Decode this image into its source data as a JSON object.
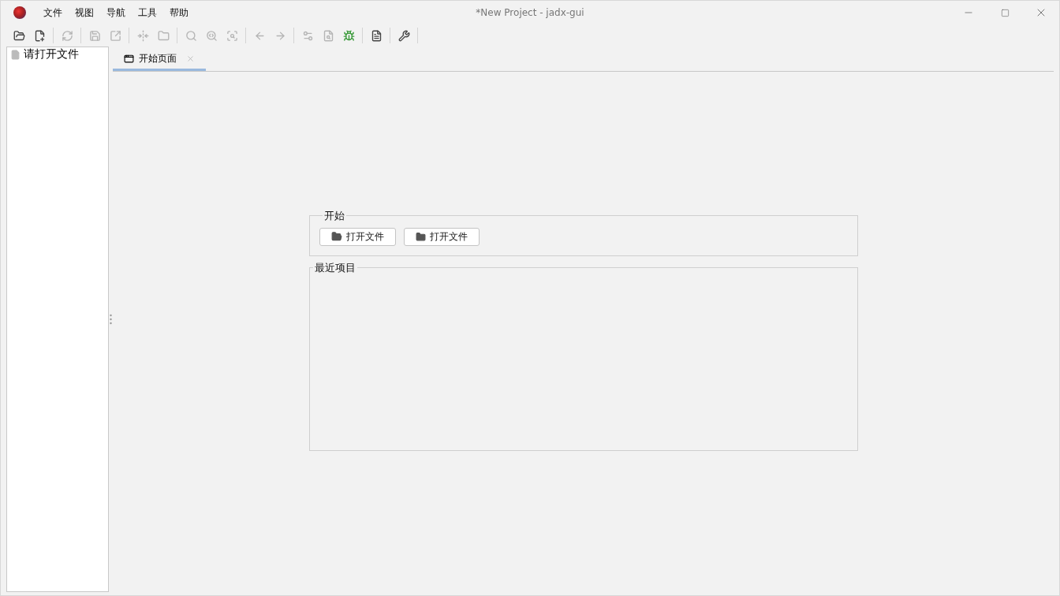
{
  "window": {
    "title": "*New Project - jadx-gui"
  },
  "menu": [
    "文件",
    "视图",
    "导航",
    "工具",
    "帮助"
  ],
  "toolbar": [
    [
      {
        "kind": "open",
        "disabled": false
      },
      {
        "kind": "add",
        "disabled": false
      }
    ],
    [
      {
        "kind": "reload",
        "disabled": true
      }
    ],
    [
      {
        "kind": "save",
        "disabled": true
      },
      {
        "kind": "export",
        "disabled": true
      }
    ],
    [
      {
        "kind": "sync",
        "disabled": true
      },
      {
        "kind": "flatten",
        "disabled": true
      }
    ],
    [
      {
        "kind": "search",
        "disabled": true
      },
      {
        "kind": "find-class",
        "disabled": true
      },
      {
        "kind": "find-usage",
        "disabled": true
      }
    ],
    [
      {
        "kind": "back",
        "disabled": true
      },
      {
        "kind": "forward",
        "disabled": true
      }
    ],
    [
      {
        "kind": "deobf",
        "disabled": true
      },
      {
        "kind": "quark",
        "disabled": true
      },
      {
        "kind": "debug",
        "disabled": false
      }
    ],
    [
      {
        "kind": "log",
        "disabled": false
      }
    ],
    [
      {
        "kind": "prefs",
        "disabled": false
      }
    ]
  ],
  "tree": {
    "items": [
      {
        "label": "请打开文件"
      }
    ]
  },
  "tabs": [
    {
      "label": "开始页面",
      "selected": true
    }
  ],
  "start": {
    "title": "开始",
    "buttons": [
      {
        "kind": "open",
        "label": "打开文件"
      },
      {
        "kind": "project",
        "label": "打开文件"
      }
    ]
  },
  "recent": {
    "title": "最近项目"
  }
}
